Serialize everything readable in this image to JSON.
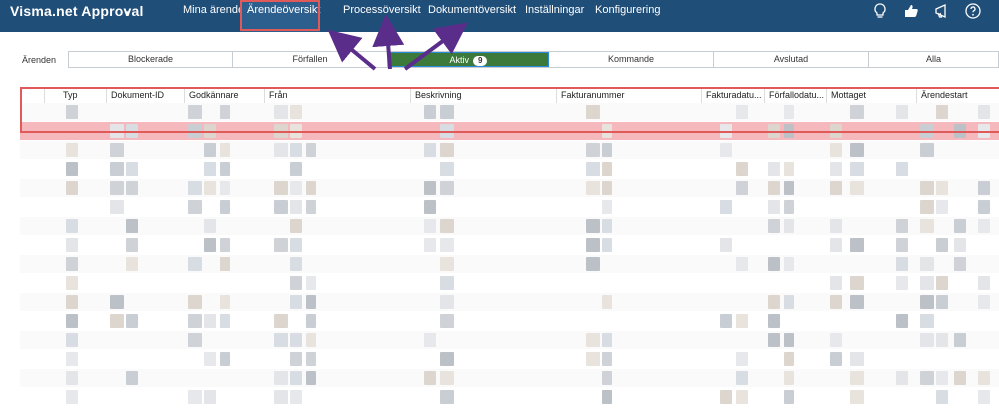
{
  "app": {
    "title": "Visma.net Approval",
    "caret_icon": "chevron-down-icon"
  },
  "nav": {
    "items": [
      {
        "label": "Mina ärenden"
      },
      {
        "label": "Ärendeöversikt",
        "active": true
      },
      {
        "label": "Processöversikt"
      },
      {
        "label": "Dokumentöversikt"
      },
      {
        "label": "Inställningar"
      },
      {
        "label": "Konfigurering"
      }
    ]
  },
  "header_icons": [
    "lightbulb-icon",
    "thumbs-icon",
    "megaphone-icon",
    "help-icon"
  ],
  "filter": {
    "label": "Ärenden",
    "tabs": [
      {
        "label": "Blockerade"
      },
      {
        "label": "Förfallen"
      },
      {
        "label": "Aktiv",
        "badge": "9",
        "active": true
      },
      {
        "label": "Kommande"
      },
      {
        "label": "Avslutad"
      },
      {
        "label": "Alla"
      }
    ]
  },
  "grid": {
    "columns": [
      "Typ",
      "Dokument-ID",
      "Godkännare",
      "Från",
      "Beskrivning",
      "Fakturanummer",
      "Fakturadatu...",
      "Förfallodatu...",
      "Mottaget",
      "Ärendestart"
    ]
  },
  "colors": {
    "topbar": "#1f4e79",
    "active_tab": "#3c7a3c",
    "highlight": "#e05a5a",
    "arrow": "#5b2d8a"
  }
}
